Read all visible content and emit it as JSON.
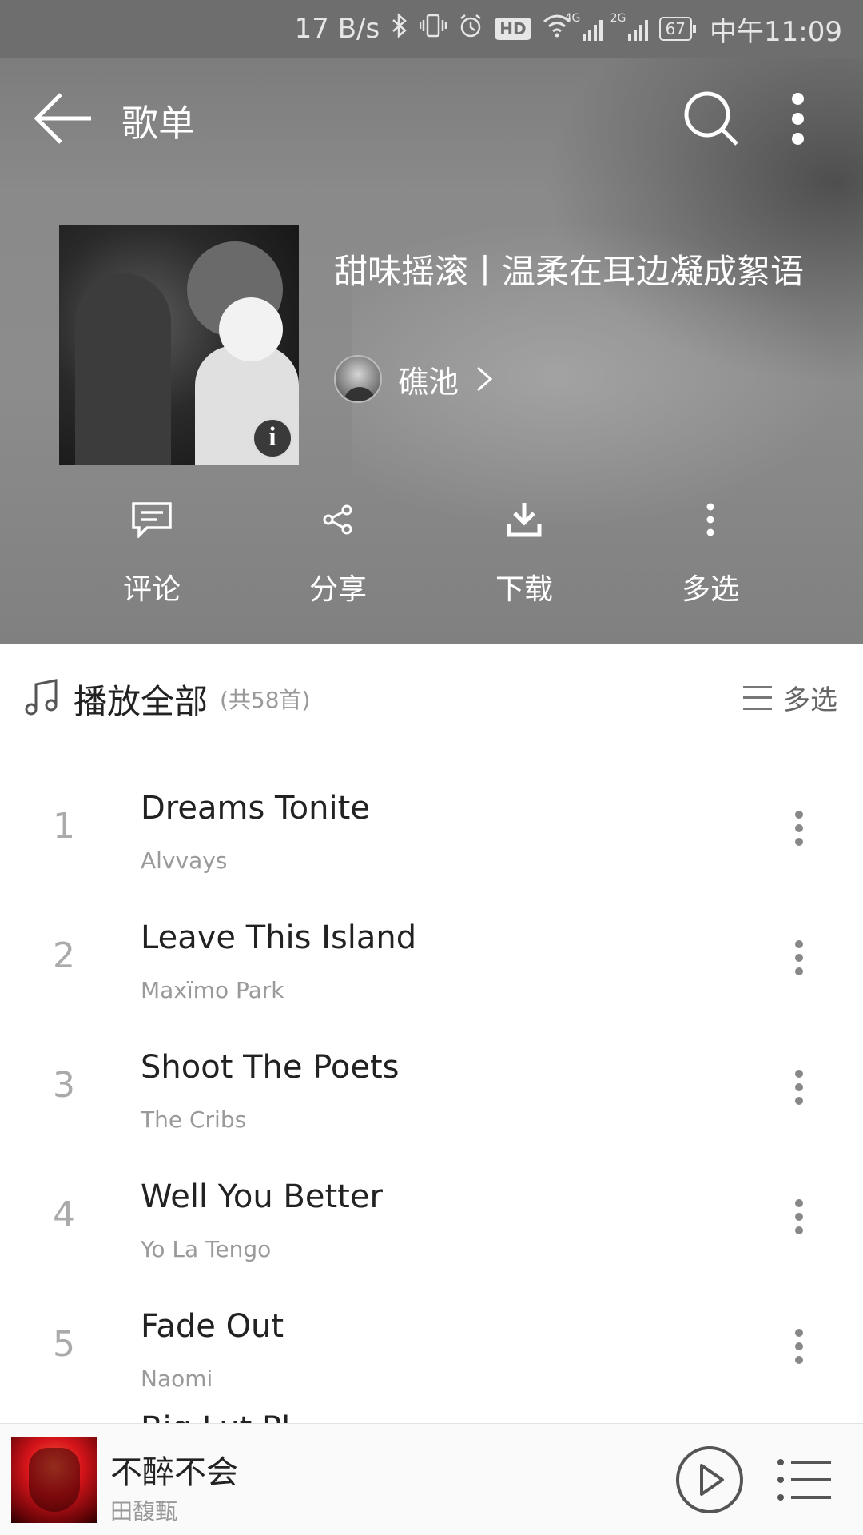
{
  "status_bar": {
    "speed": "17 B/s",
    "battery": "67",
    "time": "中午11:09",
    "net_4g": "4G",
    "net_2g": "2G",
    "hd": "HD"
  },
  "header": {
    "title": "歌单"
  },
  "playlist": {
    "name": "甜味摇滚丨温柔在耳边凝成絮语",
    "creator": "礁池"
  },
  "actions": [
    {
      "label": "评论",
      "icon": "comment-icon"
    },
    {
      "label": "分享",
      "icon": "share-icon"
    },
    {
      "label": "下载",
      "icon": "download-icon"
    },
    {
      "label": "多选",
      "icon": "more-vertical-icon"
    }
  ],
  "list": {
    "play_all_label": "播放全部",
    "count_label": "(共58首)",
    "multi_select_label": "多选",
    "songs": [
      {
        "num": "1",
        "title": "Dreams Tonite",
        "artist": "Alvvays"
      },
      {
        "num": "2",
        "title": "Leave This Island",
        "artist": "Maxïmo Park"
      },
      {
        "num": "3",
        "title": "Shoot The Poets",
        "artist": "The Cribs"
      },
      {
        "num": "4",
        "title": "Well You Better",
        "artist": "Yo La Tengo"
      },
      {
        "num": "5",
        "title": "Fade Out",
        "artist": "Naomi"
      }
    ],
    "peek_title": "Big Lut Pl"
  },
  "mini_player": {
    "title": "不醉不会",
    "artist": "田馥甄"
  },
  "colors": {
    "header_gray": "#8a8a8a",
    "status_gray": "#6e6e6e",
    "accent_red": "#d4141a"
  }
}
